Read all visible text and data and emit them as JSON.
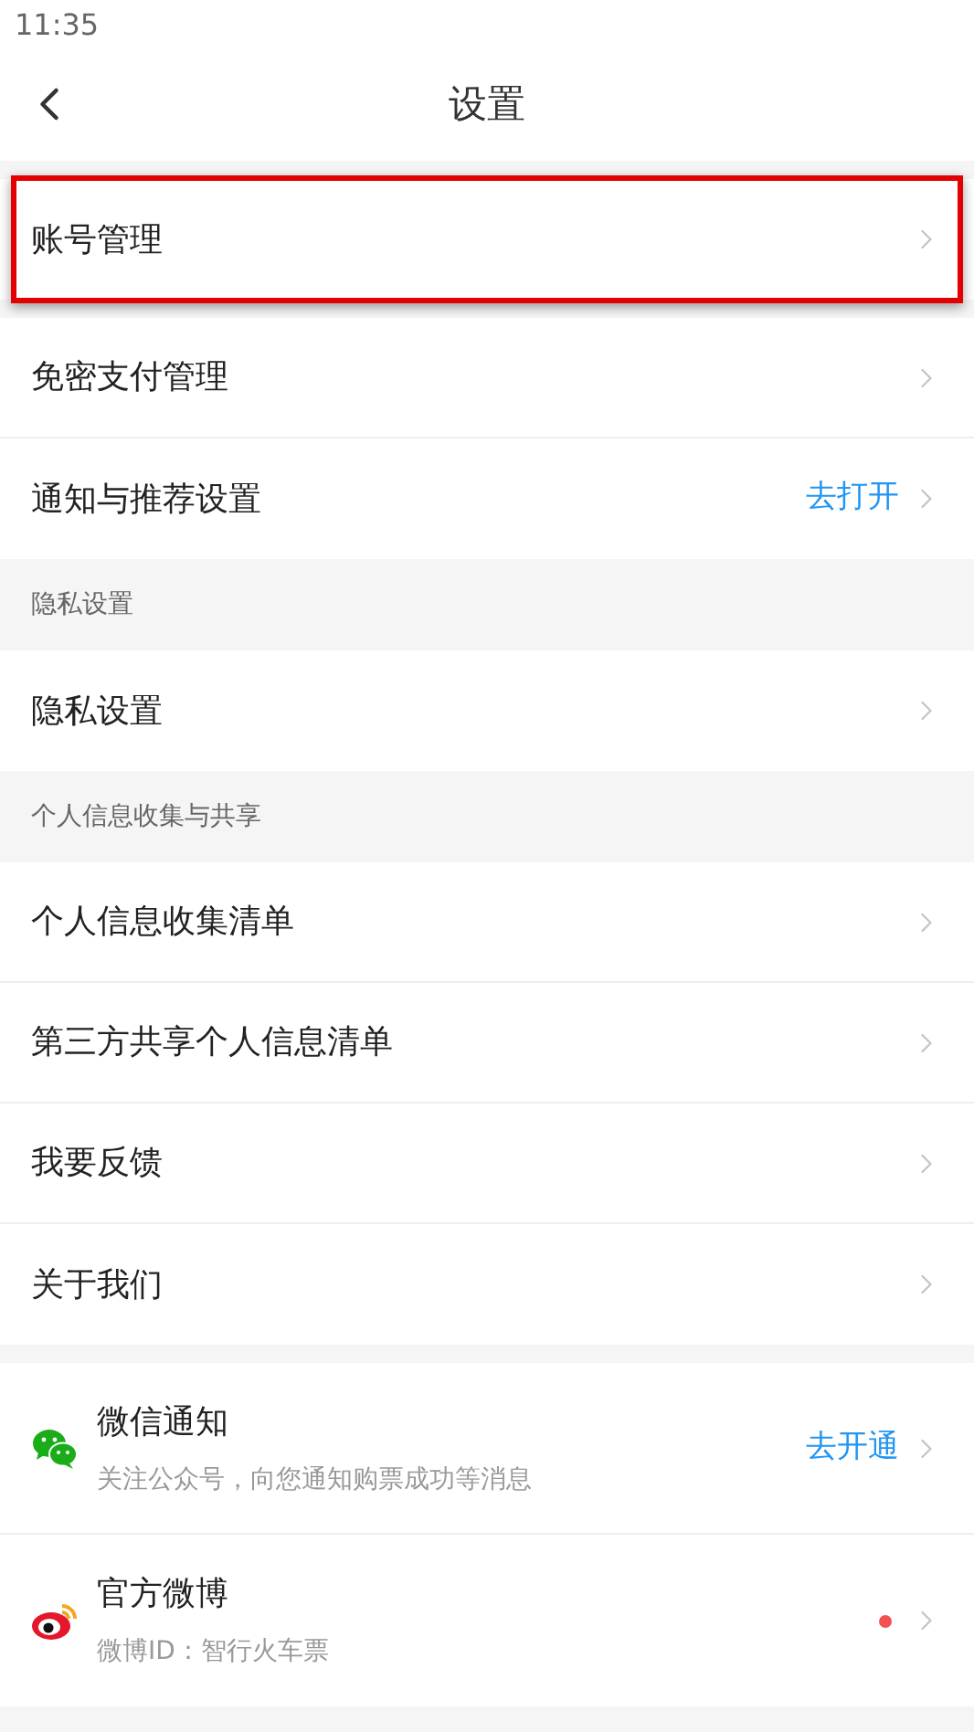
{
  "status_bar": {
    "time": "11:35"
  },
  "header": {
    "title": "设置"
  },
  "sections": [
    {
      "items": [
        {
          "label": "账号管理",
          "highlighted": true
        }
      ]
    },
    {
      "items": [
        {
          "label": "免密支付管理",
          "highlighted": false
        },
        {
          "label": "通知与推荐设置",
          "action": "去打开",
          "highlighted": false
        }
      ]
    },
    {
      "header": "隐私设置",
      "items": [
        {
          "label": "隐私设置",
          "highlighted": false
        }
      ]
    },
    {
      "header": "个人信息收集与共享",
      "items": [
        {
          "label": "个人信息收集清单",
          "highlighted": false
        },
        {
          "label": "第三方共享个人信息清单",
          "highlighted": false
        },
        {
          "label": "我要反馈",
          "highlighted": false
        },
        {
          "label": "关于我们",
          "highlighted": false
        }
      ]
    },
    {
      "items": [
        {
          "kind": "wechat",
          "label": "微信通知",
          "subtitle": "关注公众号，向您通知购票成功等消息",
          "action": "去开通",
          "highlighted": false,
          "dot": false
        },
        {
          "kind": "weibo",
          "label": "官方微博",
          "subtitle": "微博ID：智行火车票",
          "highlighted": false,
          "dot": true
        }
      ]
    }
  ]
}
